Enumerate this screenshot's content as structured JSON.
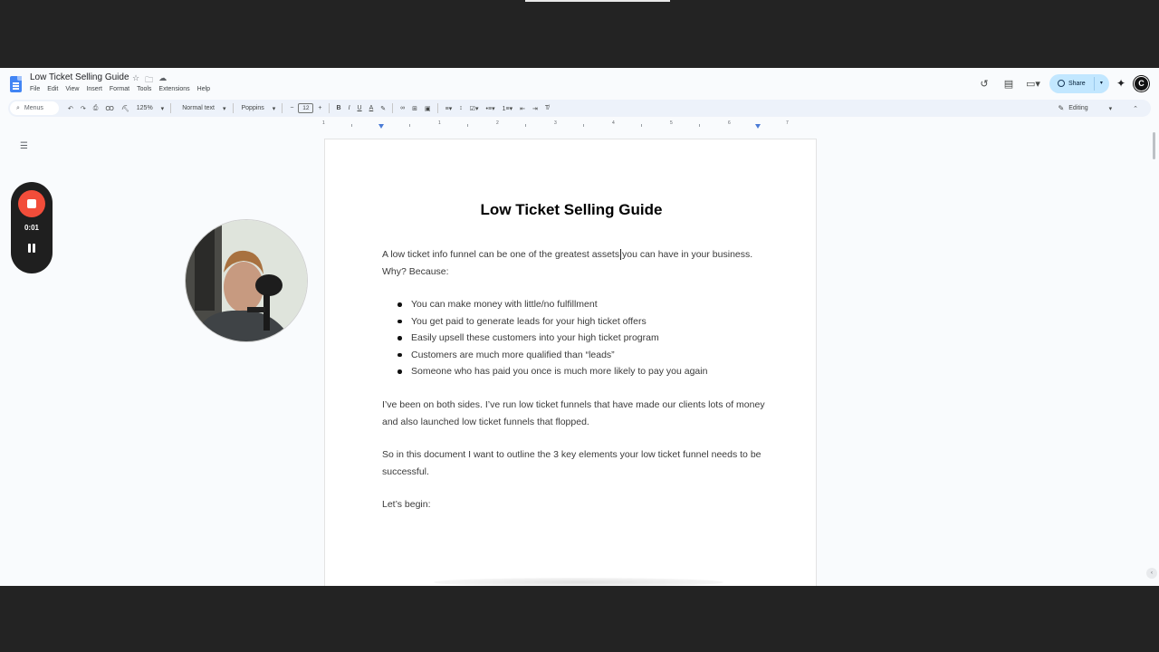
{
  "app": {
    "doc_title": "Low Ticket Selling Guide",
    "menu": [
      "File",
      "Edit",
      "View",
      "Insert",
      "Format",
      "Tools",
      "Extensions",
      "Help"
    ],
    "share_label": "Share",
    "avatar_letter": "C"
  },
  "toolbar": {
    "search_label": "Menus",
    "zoom": "125%",
    "style": "Normal text",
    "font": "Poppins",
    "font_size": "12",
    "mode": "Editing"
  },
  "ruler": {
    "labels": [
      "1",
      "1",
      "2",
      "3",
      "4",
      "5",
      "6",
      "7"
    ]
  },
  "recorder": {
    "time": "0:01",
    "stop_color": "#f24d3a"
  },
  "document": {
    "heading": "Low Ticket Selling Guide",
    "intro": "A low ticket info funnel can be one of the greatest assets you can have in your business. Why? Because:",
    "bullets": [
      "You can make money with little/no fulfillment",
      "You get paid to generate leads for your high ticket offers",
      "Easily upsell these customers into your high ticket program",
      "Customers are much more qualified than “leads”",
      "Someone who has paid you once is much more likely to pay you again"
    ],
    "para2": "I’ve been on both sides. I’ve run low ticket funnels that have made our clients lots of money and also launched low ticket funnels that flopped.",
    "para3": "So in this document I want to outline the 3 key elements your low ticket funnel needs to be successful.",
    "para4": "Let’s begin:"
  },
  "colors": {
    "accent": "#c2e7ff",
    "doc_blue": "#4285f4",
    "toolbar_bg": "#edf2fa"
  }
}
